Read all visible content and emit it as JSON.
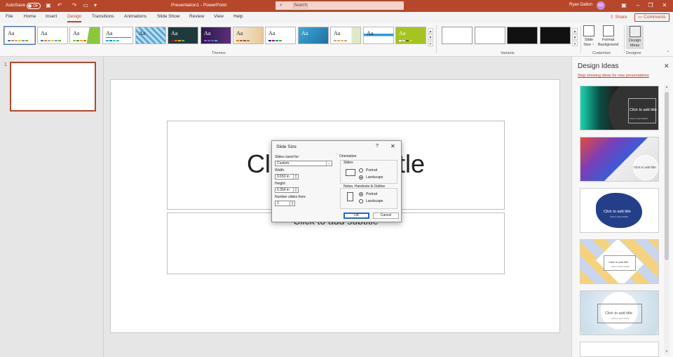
{
  "titlebar": {
    "autosave_label": "AutoSave",
    "autosave_state": "Off",
    "doc_title": "Presentation1 - PowerPoint",
    "user_name": "Ryan Dalton",
    "user_initials": "RD"
  },
  "search": {
    "placeholder": "Search"
  },
  "menu": {
    "tabs": [
      "File",
      "Home",
      "Insert",
      "Design",
      "Transitions",
      "Animations",
      "Slide Show",
      "Review",
      "View",
      "Help"
    ],
    "active_tab": "Design",
    "share_label": "Share",
    "comments_label": "Comments"
  },
  "ribbon": {
    "themes_group_label": "Themes",
    "theme_sample": "Aa",
    "variants_group_label": "Variants",
    "customize_group_label": "Customize",
    "designer_group_label": "Designer",
    "slide_size_label_1": "Slide",
    "slide_size_label_2": "Size ~",
    "format_bg_label_1": "Format",
    "format_bg_label_2": "Background",
    "design_ideas_label_1": "Design",
    "design_ideas_label_2": "Ideas"
  },
  "thumbnails": {
    "slide_number": "1"
  },
  "slide": {
    "title_placeholder": "Click to add title",
    "subtitle_placeholder": "Click to add subtitle"
  },
  "dialog": {
    "title": "Slide Size",
    "help": "?",
    "close": "✕",
    "sized_for_label": "Slides sized for:",
    "sized_for_value": "Custom",
    "width_label": "Width:",
    "width_value": "9.653 in",
    "height_label": "Height:",
    "height_value": "6.354 in",
    "number_from_label": "Number slides from:",
    "number_from_value": "1",
    "orientation_label": "Orientation",
    "slides_group_label": "Slides",
    "slides_portrait": "Portrait",
    "slides_landscape": "Landscape",
    "slides_selected": "Landscape",
    "notes_group_label": "Notes, Handouts & Outline",
    "notes_portrait": "Portrait",
    "notes_landscape": "Landscape",
    "notes_selected": "Portrait",
    "ok_label": "OK",
    "cancel_label": "Cancel"
  },
  "design_pane": {
    "title": "Design Ideas",
    "close": "✕",
    "stop_link": "Stop showing ideas for new presentations",
    "idea_title": "Click to add title",
    "idea_subtitle": "Click to add subtitle"
  },
  "colors": {
    "accent": "#b7472a",
    "dialog_primary": "#2a64c8"
  }
}
